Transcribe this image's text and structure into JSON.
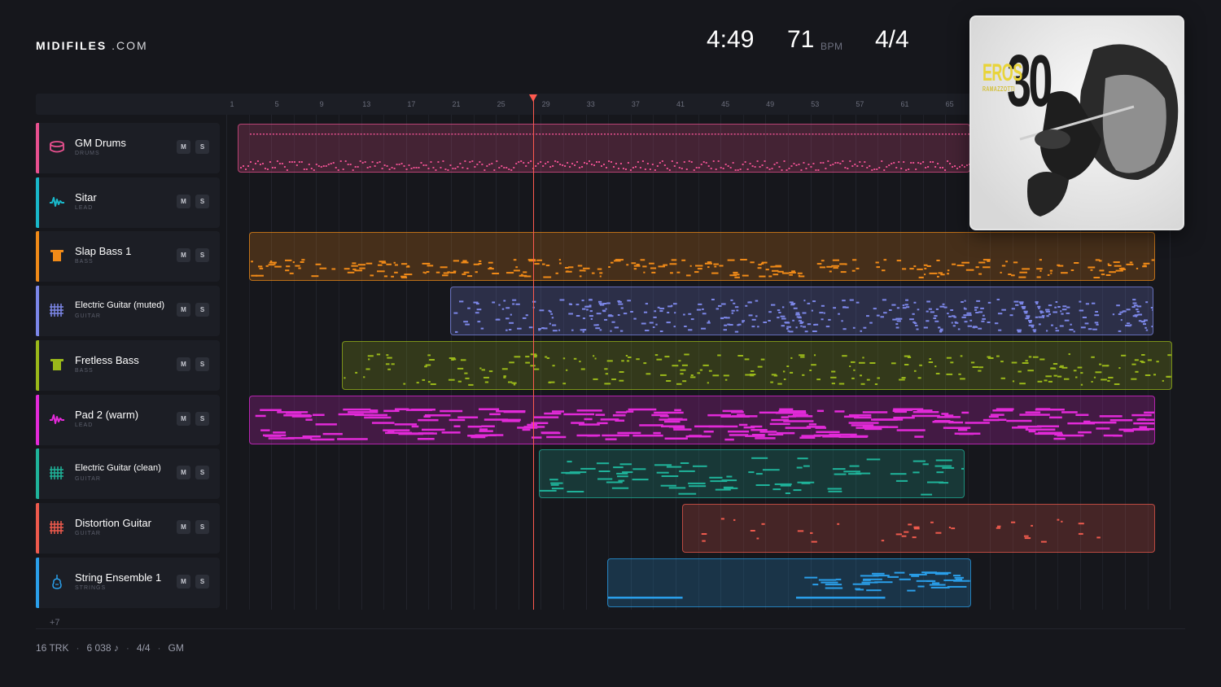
{
  "app": {
    "brand_bold": "MIDIFILES",
    "brand_rest": ".COM"
  },
  "header": {
    "time": "4:49",
    "bpm": "71",
    "bpm_unit": "BPM",
    "signature": "4/4"
  },
  "ruler": {
    "ticks": [
      "1",
      "5",
      "9",
      "13",
      "17",
      "21",
      "25",
      "29",
      "33",
      "37",
      "41",
      "45",
      "49",
      "53",
      "57",
      "61",
      "65"
    ]
  },
  "tracks": [
    {
      "name": "GM Drums",
      "category": "DRUMS",
      "color": "#e8508f",
      "icon": "drum-icon",
      "m": "M",
      "s": "S"
    },
    {
      "name": "Sitar",
      "category": "LEAD",
      "color": "#19b7c9",
      "icon": "waveform-icon",
      "m": "M",
      "s": "S"
    },
    {
      "name": "Slap Bass 1",
      "category": "BASS",
      "color": "#f08a18",
      "icon": "bass-icon",
      "m": "M",
      "s": "S"
    },
    {
      "name": "Electric Guitar (muted)",
      "category": "GUITAR",
      "color": "#7c87e8",
      "icon": "guitar-fret-icon",
      "m": "M",
      "s": "S"
    },
    {
      "name": "Fretless Bass",
      "category": "BASS",
      "color": "#9ab81a",
      "icon": "bass-icon",
      "m": "M",
      "s": "S"
    },
    {
      "name": "Pad 2 (warm)",
      "category": "LEAD",
      "color": "#e22ad8",
      "icon": "waveform-icon",
      "m": "M",
      "s": "S"
    },
    {
      "name": "Electric Guitar (clean)",
      "category": "GUITAR",
      "color": "#1fb39a",
      "icon": "guitar-fret-icon",
      "m": "M",
      "s": "S"
    },
    {
      "name": "Distortion Guitar",
      "category": "GUITAR",
      "color": "#ee5a4d",
      "icon": "guitar-fret-icon",
      "m": "M",
      "s": "S"
    },
    {
      "name": "String Ensemble 1",
      "category": "STRINGS",
      "color": "#2a9fea",
      "icon": "violin-icon",
      "m": "M",
      "s": "S"
    }
  ],
  "more_tracks": "+7",
  "footer": {
    "tracks": "16 TRK",
    "notes": "6 038 ♪",
    "signature": "4/4",
    "standard": "GM"
  },
  "cover": {
    "title": "EROS",
    "subtitle": "RAMAZZOTTI",
    "number": "30"
  }
}
